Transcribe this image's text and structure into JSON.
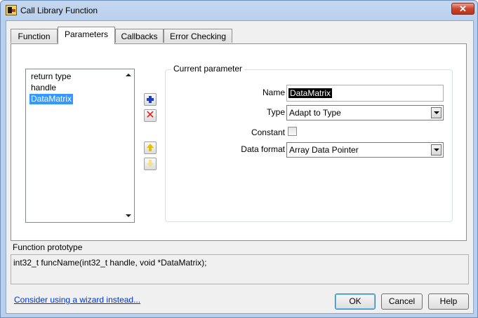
{
  "window": {
    "title": "Call Library Function",
    "close_glyph": "✕"
  },
  "tabs": [
    {
      "label": "Function",
      "active": false
    },
    {
      "label": "Parameters",
      "active": true
    },
    {
      "label": "Callbacks",
      "active": false
    },
    {
      "label": "Error Checking",
      "active": false
    }
  ],
  "parameter_list": {
    "items": [
      "return type",
      "handle",
      "DataMatrix"
    ],
    "selected": "DataMatrix"
  },
  "list_buttons": {
    "add_icon": "plus-icon",
    "delete_icon": "x-icon",
    "delete_glyph": "✕",
    "move_up_icon": "arrow-up-icon",
    "move_down_icon": "arrow-down-icon"
  },
  "current_parameter": {
    "group_title": "Current parameter",
    "name_label": "Name",
    "name_value": "DataMatrix",
    "type_label": "Type",
    "type_value": "Adapt to Type",
    "constant_label": "Constant",
    "constant_checked": false,
    "data_format_label": "Data format",
    "data_format_value": "Array Data Pointer"
  },
  "prototype": {
    "label": "Function prototype",
    "text": "int32_t funcName(int32_t handle, void *DataMatrix);"
  },
  "footer": {
    "wizard_link": "Consider using a wizard instead...",
    "ok_label": "OK",
    "cancel_label": "Cancel",
    "help_label": "Help"
  },
  "colors": {
    "selection": "#3399ff",
    "link": "#0033cc",
    "close_button": "#c9462e",
    "add_icon": "#1d3fbf",
    "delete_icon": "#e01b1b",
    "move_icon": "#e6c000"
  }
}
